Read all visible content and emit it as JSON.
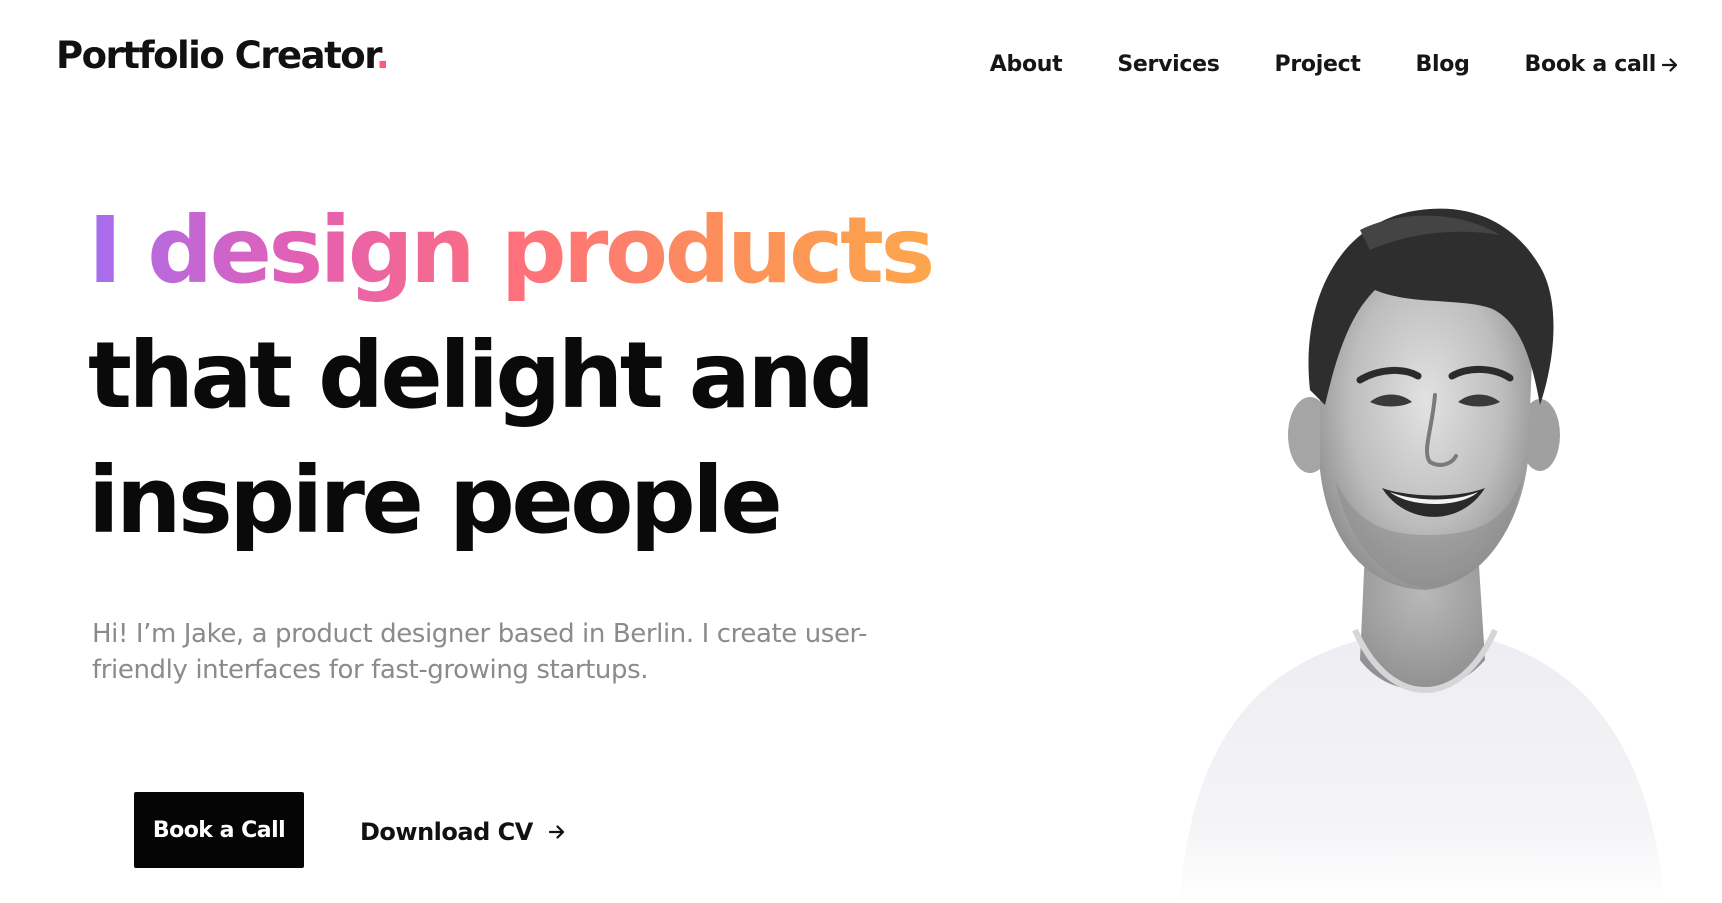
{
  "brand": {
    "name": "Portfolio Creator",
    "dot": ".",
    "dot_color": "#ff5a79"
  },
  "nav": {
    "items": [
      {
        "label": "About"
      },
      {
        "label": "Services"
      },
      {
        "label": "Project"
      },
      {
        "label": "Blog"
      },
      {
        "label": "Book a call",
        "icon": "arrow-right-icon"
      }
    ]
  },
  "hero": {
    "title_line1": "I design products",
    "title_line2": "that delight and",
    "title_line3": "inspire people",
    "gradient_colors": [
      "#a56ef0",
      "#e45fb4",
      "#fd6f7d",
      "#fd8f5b",
      "#fda64b"
    ],
    "intro": "Hi! I’m Jake, a product designer based in Berlin. I create user-friendly interfaces for fast-growing startups."
  },
  "actions": {
    "primary_label": "Book a Call",
    "secondary_label": "Download CV",
    "secondary_icon": "arrow-right-icon"
  },
  "portrait": {
    "style": "black-and-white photo",
    "subject": "smiling man in white t-shirt"
  }
}
